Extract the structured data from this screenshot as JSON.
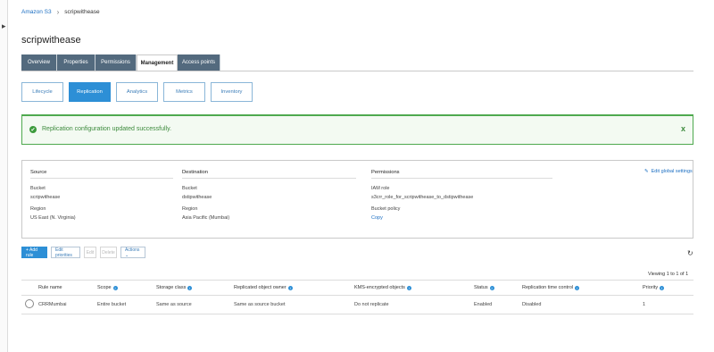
{
  "breadcrumb": {
    "root": "Amazon S3",
    "separator": "›",
    "current": "scripwithease"
  },
  "page_title": "scripwithease",
  "tabs": [
    {
      "label": "Overview",
      "active": false
    },
    {
      "label": "Properties",
      "active": false
    },
    {
      "label": "Permissions",
      "active": false
    },
    {
      "label": "Management",
      "active": true
    },
    {
      "label": "Access points",
      "active": false
    }
  ],
  "subtabs": [
    {
      "label": "Lifecycle",
      "active": false
    },
    {
      "label": "Replication",
      "active": true
    },
    {
      "label": "Analytics",
      "active": false
    },
    {
      "label": "Metrics",
      "active": false
    },
    {
      "label": "Inventory",
      "active": false
    }
  ],
  "alert": {
    "message": "Replication configuration updated successfully.",
    "close": "x"
  },
  "config": {
    "source": {
      "heading": "Source",
      "bucket_label": "Bucket",
      "bucket": "scripwithease",
      "region_label": "Region",
      "region": "US East (N. Virginia)"
    },
    "destination": {
      "heading": "Destination",
      "bucket_label": "Bucket",
      "bucket": "dstipwithease",
      "region_label": "Region",
      "region": "Asia Pacific (Mumbai)"
    },
    "permissions": {
      "heading": "Permissions",
      "iam_label": "IAM role",
      "iam_role": "s3crr_role_for_scripwithease_to_dstipwithease",
      "policy_label": "Bucket policy",
      "policy_link": "Copy"
    },
    "edit_global": "Edit global settings"
  },
  "toolbar": {
    "add_rule": "+ Add rule",
    "edit_priorities": "Edit priorities",
    "edit": "Edit",
    "delete": "Delete",
    "actions": "Actions ⌄"
  },
  "table": {
    "viewing": "Viewing 1 to 1 of 1",
    "columns": [
      "Rule name",
      "Scope",
      "Storage class",
      "Replicated object owner",
      "KMS-encrypted objects",
      "Status",
      "Replication time control",
      "Priority"
    ],
    "info_columns": [
      false,
      true,
      true,
      true,
      true,
      true,
      true,
      true
    ],
    "rows": [
      [
        "CRRMumbai",
        "Entire bucket",
        "Same as source",
        "Same as source bucket",
        "Do not replicate",
        "Enabled",
        "Disabled",
        "1"
      ]
    ]
  },
  "icons": {
    "info": "i",
    "check": "✔",
    "refresh": "↻",
    "pencil": "✎"
  },
  "colors": {
    "tab_bg": "#536a7e",
    "accent": "#2d8fd6",
    "success": "#3c9b3c"
  }
}
